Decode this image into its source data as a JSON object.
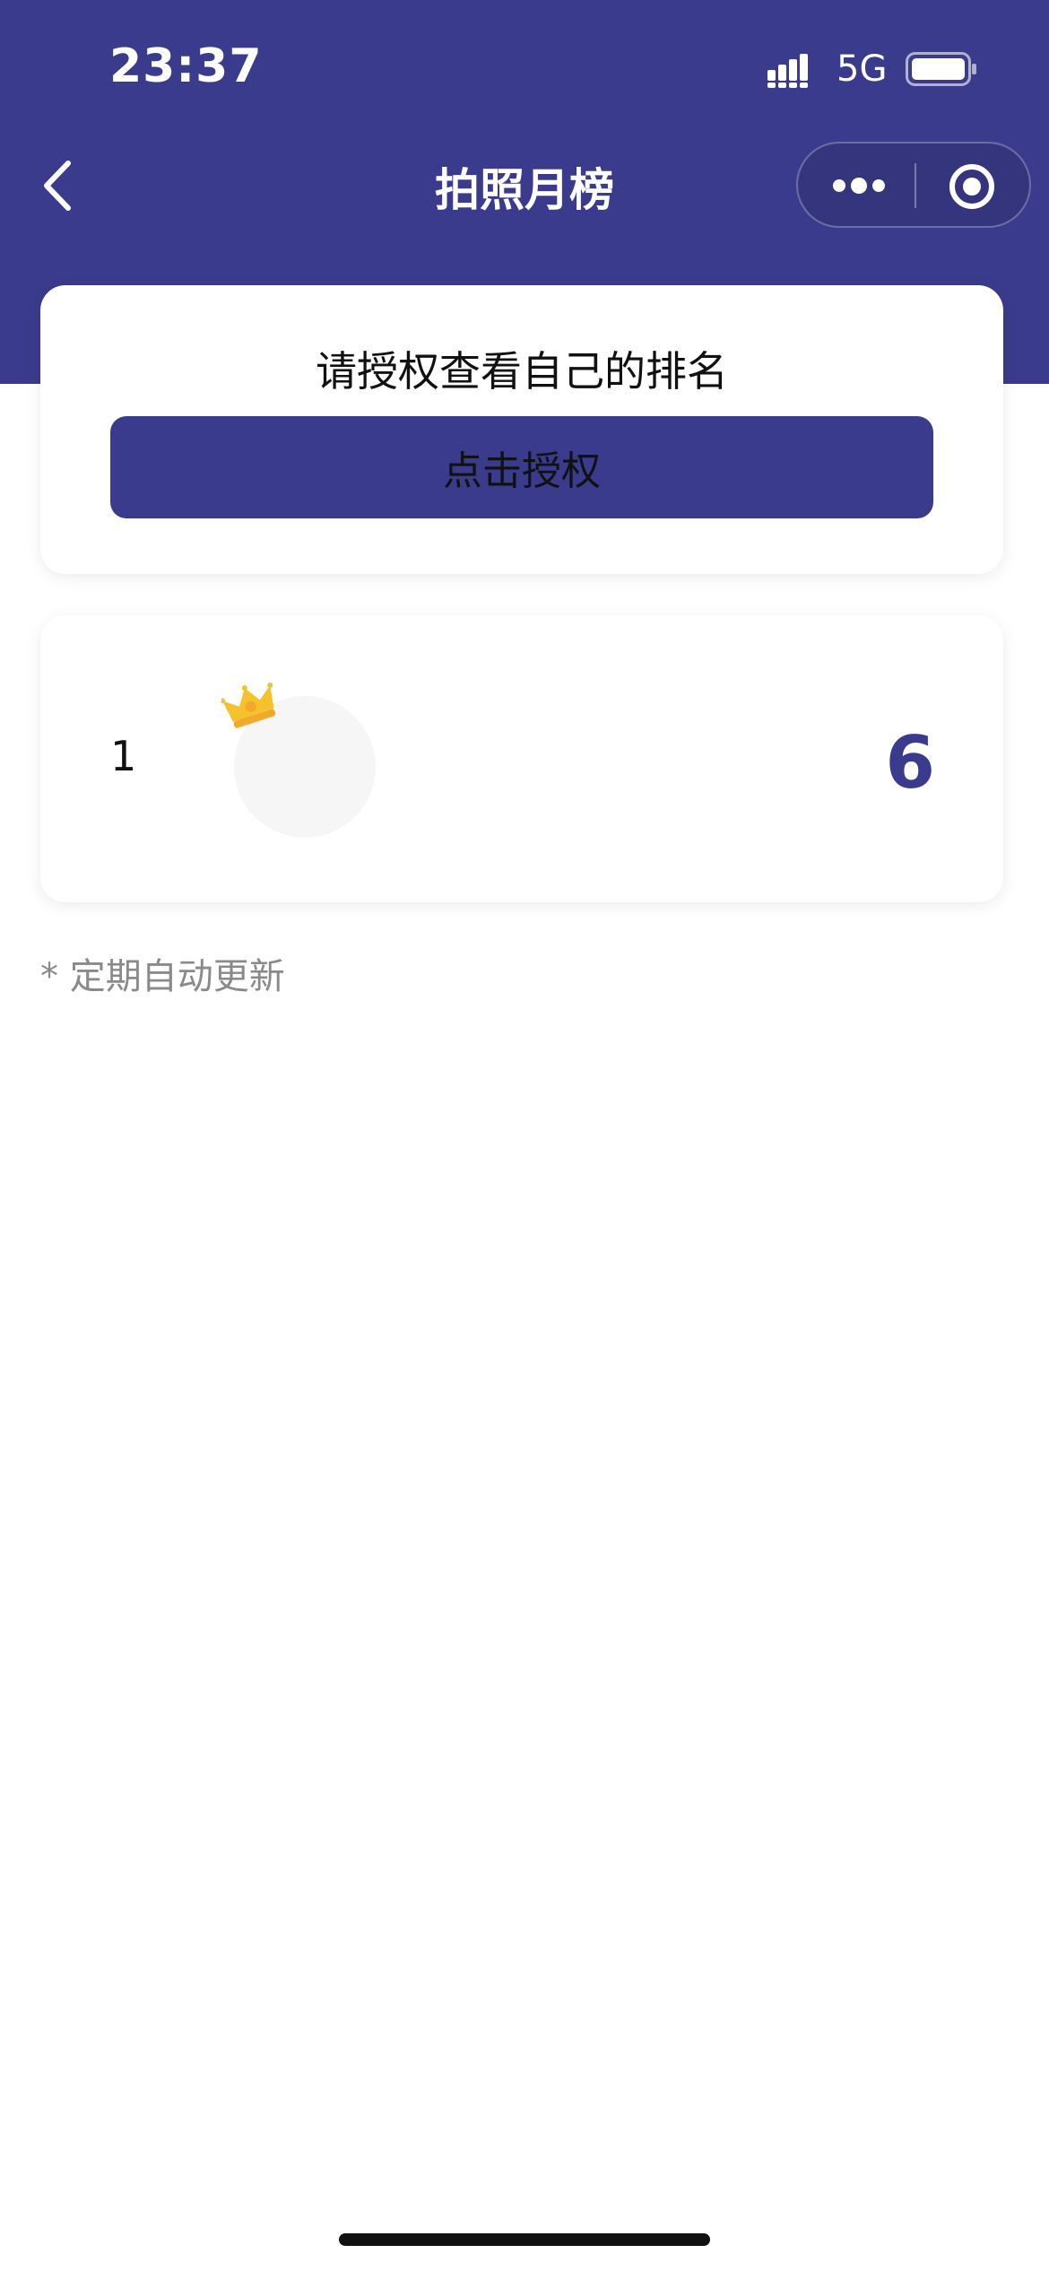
{
  "status_bar": {
    "time": "23:37",
    "network": "5G"
  },
  "nav": {
    "title": "拍照月榜"
  },
  "auth_card": {
    "prompt": "请授权查看自己的排名",
    "button_label": "点击授权"
  },
  "ranking": {
    "items": [
      {
        "rank": "1",
        "score": "6"
      }
    ]
  },
  "footnote": "* 定期自动更新",
  "colors": {
    "brand": "#3a3b8c",
    "crown": "#f5c22e"
  }
}
